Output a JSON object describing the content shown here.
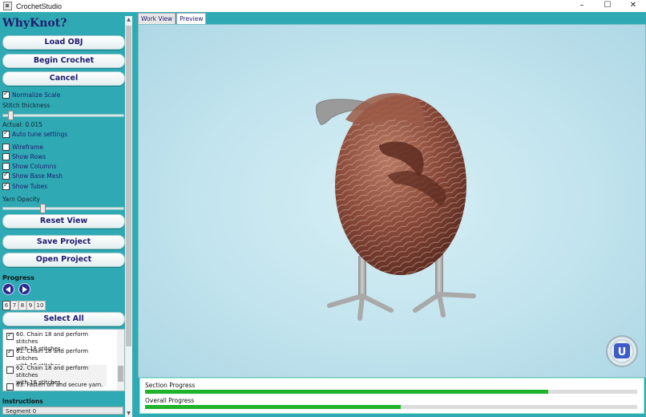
{
  "window": {
    "title": "CrochetStudio",
    "controls": {
      "minimize": "–",
      "maximize": "☐",
      "close": "✕"
    }
  },
  "sidebar": {
    "brand": "WhyKnot?",
    "buttons": {
      "load_obj": "Load OBJ",
      "begin_crochet": "Begin Crochet",
      "cancel": "Cancel",
      "reset_view": "Reset View",
      "save_project": "Save Project",
      "open_project": "Open Project",
      "select_all": "Select All"
    },
    "normalize_scale": {
      "label": "Normalize Scale",
      "checked": true
    },
    "stitch_thickness": {
      "label": "Stitch thickness",
      "value_fraction": 0.05
    },
    "actual": "Actual: 0.015",
    "auto_tune": {
      "label": "Auto tune settings",
      "checked": true
    },
    "toggles": [
      {
        "label": "Wireframe",
        "checked": false
      },
      {
        "label": "Show Rows",
        "checked": false
      },
      {
        "label": "Show Columns",
        "checked": false
      },
      {
        "label": "Show Base Mesh",
        "checked": true
      },
      {
        "label": "Show Tubes",
        "checked": true
      }
    ],
    "yarn_opacity": {
      "label": "Yarn Opacity",
      "value_fraction": 0.32
    },
    "progress": {
      "heading": "Progress",
      "pages": [
        "6",
        "7",
        "8",
        "9",
        "10"
      ],
      "active_page": "6"
    },
    "steps": [
      {
        "line1": "60. Chain 18 and perform stitches",
        "line2": "with 18 stitches.",
        "checked": true
      },
      {
        "line1": "61. Chain 18 and perform stitches",
        "line2": "with 18 stitches.",
        "checked": true
      },
      {
        "line1": "62. Chain 18 and perform stitches",
        "line2": "with 18 stitches.",
        "checked": false
      },
      {
        "line1": "63. Fasten off and secure yarn.",
        "line2": "",
        "checked": false
      }
    ],
    "instructions": {
      "heading": "Instructions",
      "segment": "Segment 0"
    }
  },
  "main": {
    "tabs": [
      "Work View",
      "Preview"
    ],
    "active_tab": "Preview",
    "section_progress": {
      "label": "Section Progress",
      "value_fraction": 0.82
    },
    "overall_progress": {
      "label": "Overall Progress",
      "value_fraction": 0.52
    },
    "colors": {
      "yarn": "#8a4a3a",
      "legs": "#a9a9a9",
      "fill": "#1fb32c",
      "panel": "#2faab4"
    }
  }
}
